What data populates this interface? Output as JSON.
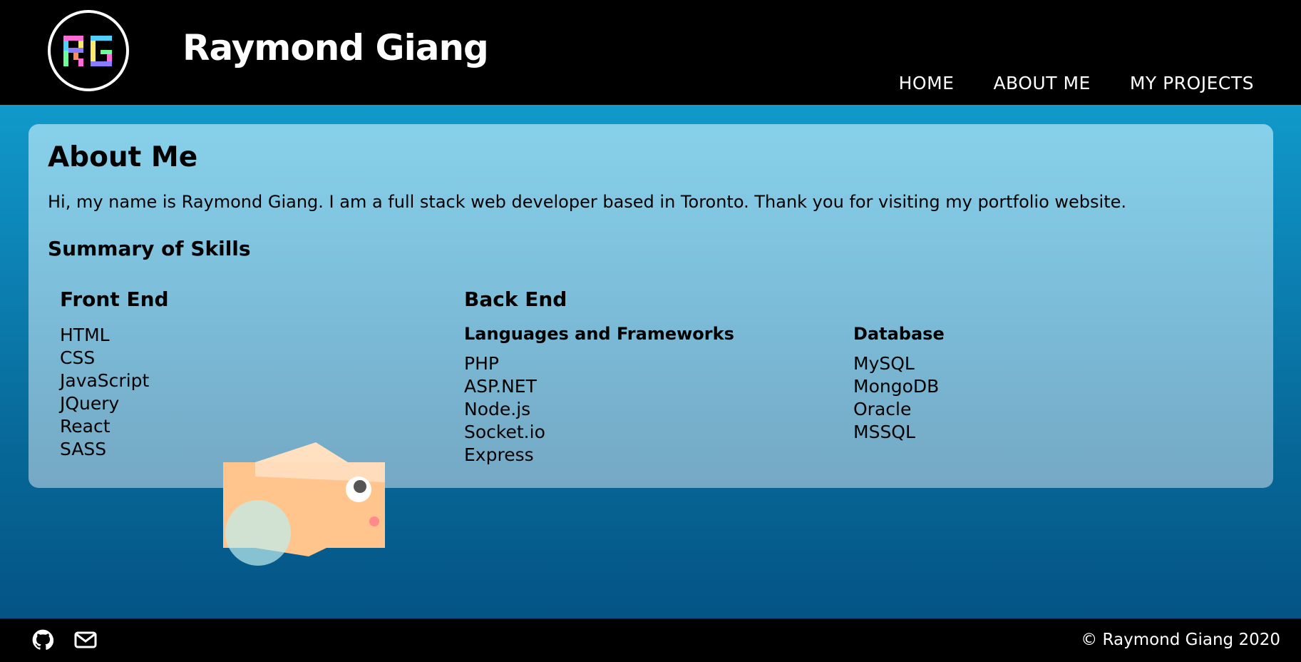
{
  "header": {
    "logo_text": "RG",
    "site_title": "Raymond Giang",
    "nav": [
      {
        "label": "HOME"
      },
      {
        "label": "ABOUT ME"
      },
      {
        "label": "MY PROJECTS"
      }
    ]
  },
  "about": {
    "title": "About Me",
    "intro": "Hi, my name is Raymond Giang. I am a full stack web developer based in Toronto. Thank you for visiting my portfolio website.",
    "skills_heading": "Summary of Skills",
    "front_end": {
      "title": "Front End",
      "items": [
        "HTML",
        "CSS",
        "JavaScript",
        "JQuery",
        "React",
        "SASS"
      ]
    },
    "back_end": {
      "title": "Back End",
      "languages": {
        "title": "Languages and Frameworks",
        "items": [
          "PHP",
          "ASP.NET",
          "Node.js",
          "Socket.io",
          "Express"
        ]
      },
      "database": {
        "title": "Database",
        "items": [
          "MySQL",
          "MongoDB",
          "Oracle",
          "MSSQL"
        ]
      }
    }
  },
  "footer": {
    "icons": [
      "github-icon",
      "mail-icon"
    ],
    "copyright": "© Raymond Giang 2020"
  },
  "colors": {
    "header_bg": "#000000",
    "page_gradient_top": "#13a9da",
    "page_gradient_bottom": "#034f80",
    "fish_body": "#ffc58c"
  }
}
